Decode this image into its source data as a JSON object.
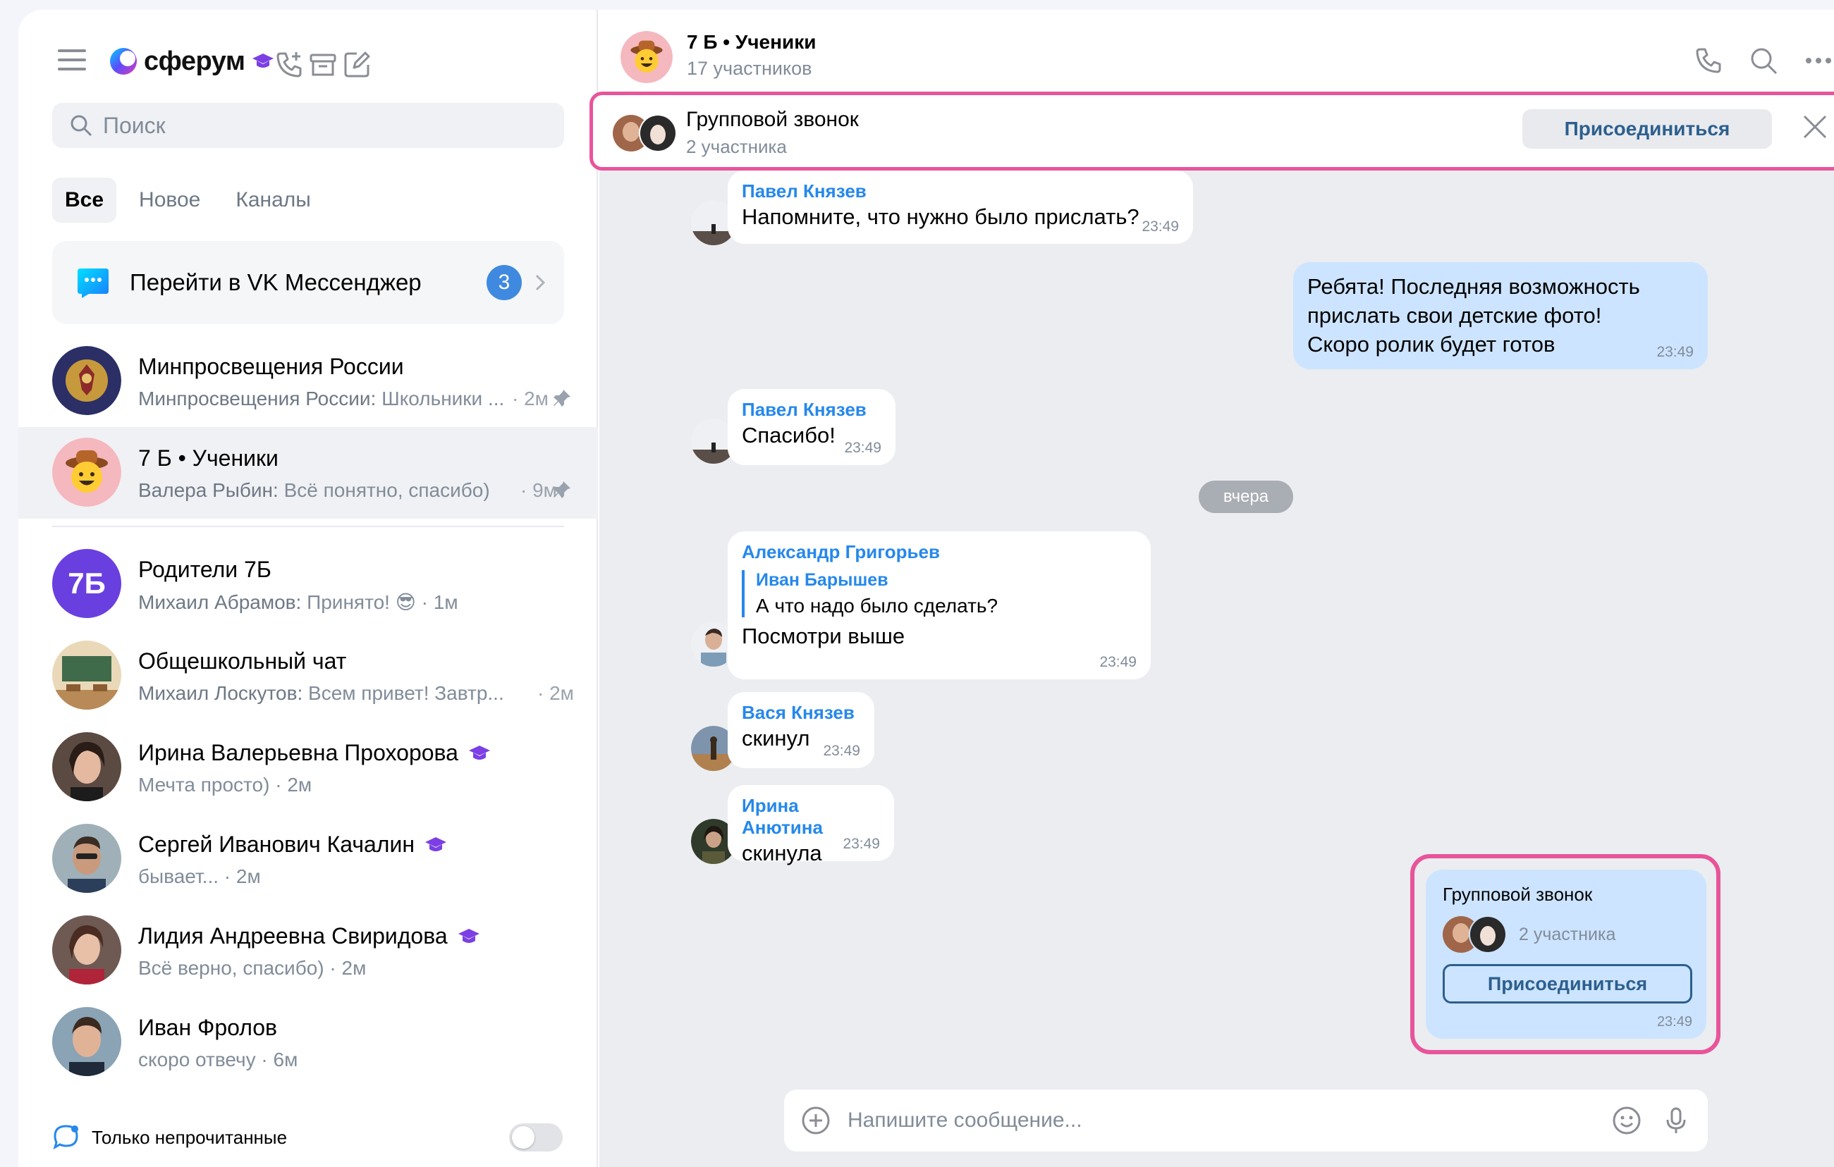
{
  "app": {
    "logo_text": "сферум",
    "colors": {
      "accent": "#2688eb",
      "highlight": "#e8549a",
      "brand_purple": "#7b3fe4",
      "badge": "#3f8ae0"
    }
  },
  "sidebar": {
    "search_placeholder": "Поиск",
    "filters": [
      {
        "label": "Все"
      },
      {
        "label": "Новое"
      },
      {
        "label": "Каналы"
      }
    ],
    "vk_banner": {
      "label": "Перейти в VK Мессенджер",
      "badge": "3"
    },
    "chats": [
      {
        "name": "Минпросвещения России",
        "author": "Минпросвещения России:",
        "preview": "Школьники ...",
        "time": "· 2м",
        "pinned": true
      },
      {
        "name": "7 Б • Ученики",
        "author": "Валера Рыбин:",
        "preview": "Всё понятно, спасибо)",
        "time": "· 9м",
        "pinned": true
      },
      {
        "name": "Родители 7Б",
        "author": "Михаил Абрамов:",
        "preview": "Принято! 😎 · 1м",
        "time": "",
        "avatar_text": "7Б"
      },
      {
        "name": "Общешкольный чат",
        "author": "Михаил Лоскутов:",
        "preview": "Всем привет! Завтр...",
        "time": "· 2м"
      },
      {
        "name": "Ирина Валерьевна Прохорова",
        "author": "",
        "preview": "Мечта просто) · 2м",
        "time": "",
        "verified": true
      },
      {
        "name": "Сергей Иванович Качалин",
        "author": "",
        "preview": "бывает... · 2м",
        "time": "",
        "verified": true
      },
      {
        "name": "Лидия Андреевна Свиридова",
        "author": "",
        "preview": "Всё верно, спасибо) · 2м",
        "time": "",
        "verified": true
      },
      {
        "name": "Иван Фролов",
        "author": "",
        "preview": "скоро отвечу · 6м",
        "time": ""
      }
    ],
    "unread_only_label": "Только непрочитанные"
  },
  "chat": {
    "title": "7 Б • Ученики",
    "subtitle": "17 участников",
    "call_bar": {
      "title": "Групповой звонок",
      "subtitle": "2 участника",
      "join_label": "Присоединиться"
    },
    "messages": [
      {
        "author": "Павел Князев",
        "text": "Напомните, что нужно было прислать?",
        "time": "23:49"
      },
      {
        "outgoing": true,
        "lines": [
          "Ребята! Последняя возможность",
          "прислать свои детские фото!",
          "Скоро ролик будет готов"
        ],
        "time": "23:49"
      },
      {
        "author": "Павел Князев",
        "text": "Спасибо!",
        "time": "23:49"
      },
      {
        "author": "Александр Григорьев",
        "reply_author": "Иван Барышев",
        "reply_text": "А что надо было сделать?",
        "text": "Посмотри выше",
        "time": "23:49"
      },
      {
        "author": "Вася Князев",
        "text": "скинул",
        "time": "23:49"
      },
      {
        "author": "Ирина Анютина",
        "text": "скинула",
        "time": "23:49"
      }
    ],
    "date_separator": "вчера",
    "call_card": {
      "title": "Групповой звонок",
      "subtitle": "2 участника",
      "join_label": "Присоединиться",
      "time": "23:49"
    },
    "composer_placeholder": "Напишите сообщение..."
  }
}
